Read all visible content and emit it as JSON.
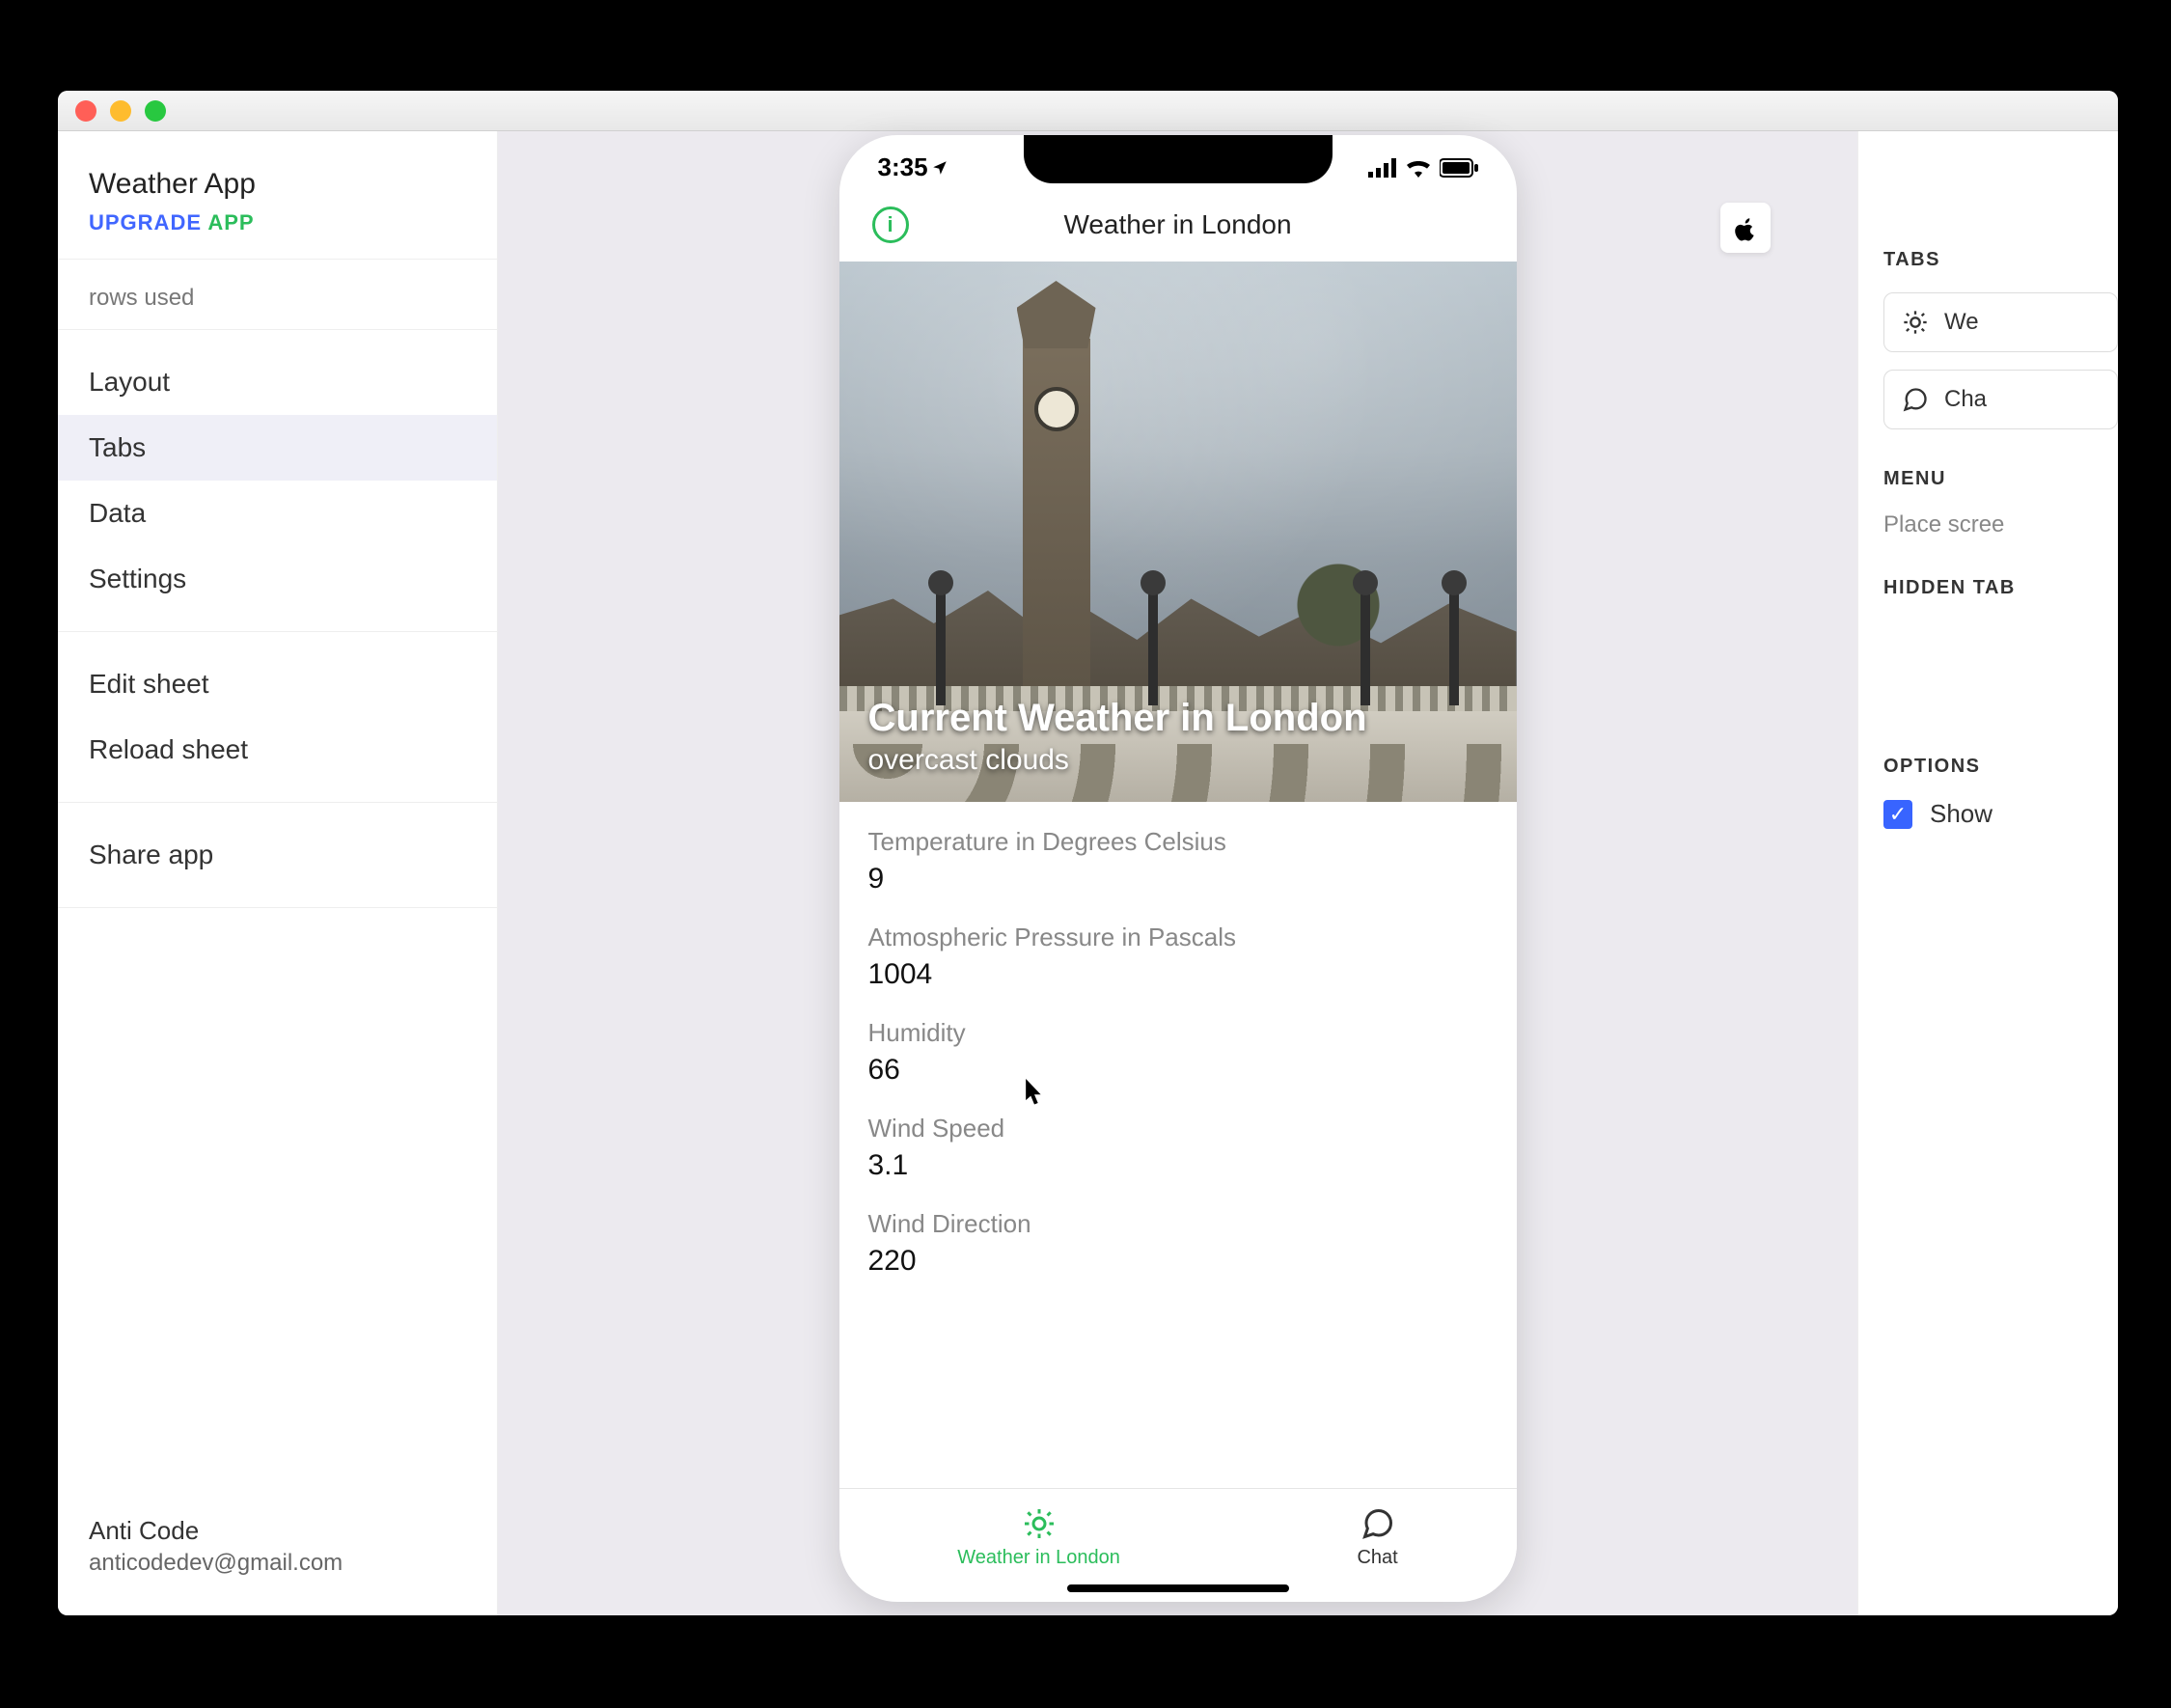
{
  "sidebar": {
    "app_name": "Weather App",
    "upgrade_1": "UPGRADE ",
    "upgrade_2": "APP",
    "rows_used": "rows used",
    "nav": {
      "layout": "Layout",
      "tabs": "Tabs",
      "data": "Data",
      "settings": "Settings"
    },
    "actions": {
      "edit_sheet": "Edit sheet",
      "reload_sheet": "Reload sheet",
      "share_app": "Share app"
    },
    "user": {
      "name": "Anti Code",
      "email": "anticodedev@gmail.com"
    }
  },
  "phone": {
    "status_time": "3:35",
    "page_title": "Weather in London",
    "hero": {
      "title": "Current Weather in London",
      "subtitle": "overcast clouds"
    },
    "fields": [
      {
        "label": "Temperature in Degrees Celsius",
        "value": "9"
      },
      {
        "label": "Atmospheric Pressure in Pascals",
        "value": "1004"
      },
      {
        "label": "Humidity",
        "value": "66"
      },
      {
        "label": "Wind Speed",
        "value": "3.1"
      },
      {
        "label": "Wind Direction",
        "value": "220"
      }
    ],
    "tabs": {
      "weather": "Weather in London",
      "chat": "Chat"
    }
  },
  "right": {
    "tabs_heading": "TABS",
    "chip_weather": "We",
    "chip_chat": "Cha",
    "menu_heading": "MENU",
    "menu_desc": "Place scree",
    "hidden_heading": "HIDDEN TAB",
    "options_heading": "OPTIONS",
    "show_label": "Show"
  }
}
